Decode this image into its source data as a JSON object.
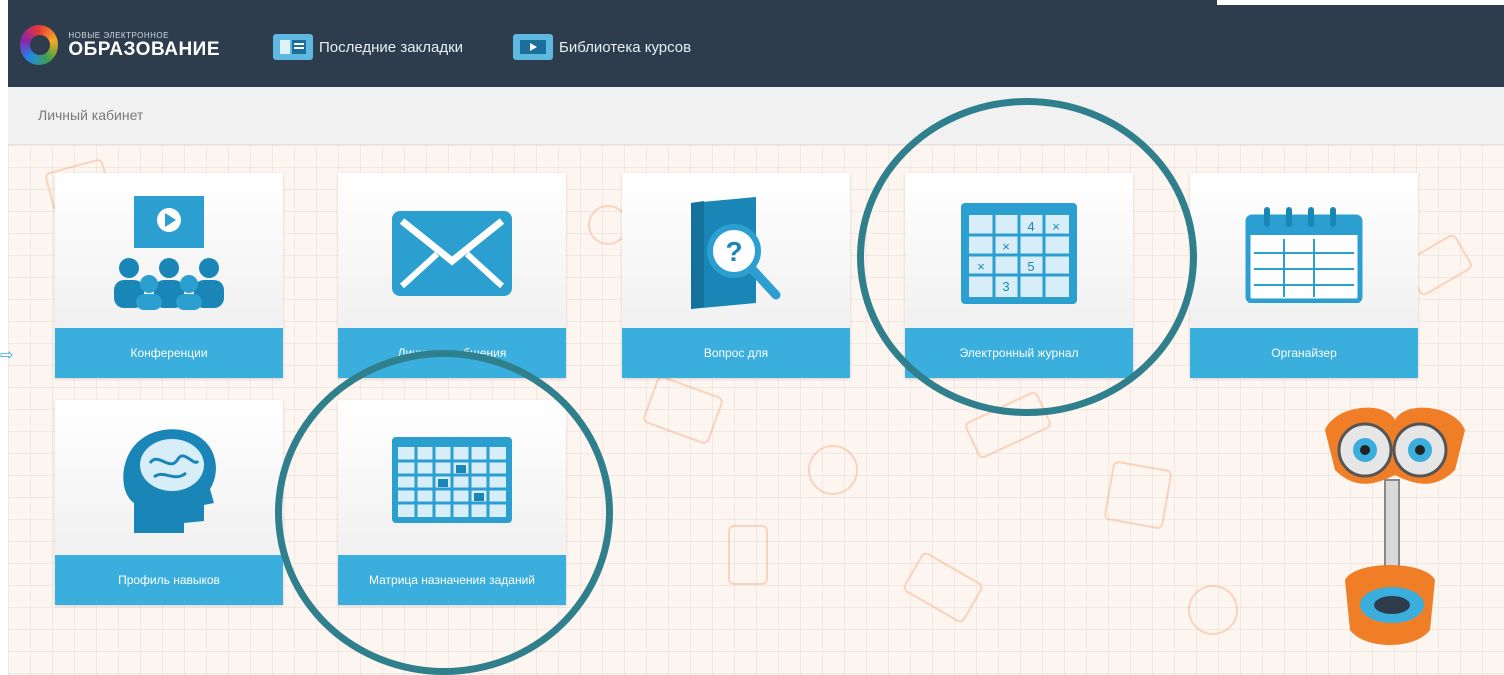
{
  "header": {
    "logo_small": "НОВЫЕ ЭЛЕКТРОННОЕ",
    "logo_big": "ОБРАЗОВАНИЕ",
    "nav": [
      {
        "label": "Последние закладки",
        "icon": "bookmarks-icon"
      },
      {
        "label": "Библиотека курсов",
        "icon": "library-icon"
      }
    ]
  },
  "breadcrumb": "Личный кабинет",
  "tiles": [
    {
      "label": "Конференции",
      "icon": "conference-icon"
    },
    {
      "label": "Личные сообщения",
      "icon": "envelope-icon"
    },
    {
      "label": "Вопрос для",
      "icon": "question-book-icon"
    },
    {
      "label": "Электронный журнал",
      "icon": "grade-journal-icon"
    },
    {
      "label": "Органайзер",
      "icon": "calendar-icon"
    },
    {
      "label": "Профиль навыков",
      "icon": "brain-head-icon"
    },
    {
      "label": "Матрица назначения заданий",
      "icon": "task-matrix-icon"
    }
  ],
  "colors": {
    "header_bg": "#2e3d4d",
    "accent": "#3aaedc",
    "circle": "#2f7f8c"
  }
}
